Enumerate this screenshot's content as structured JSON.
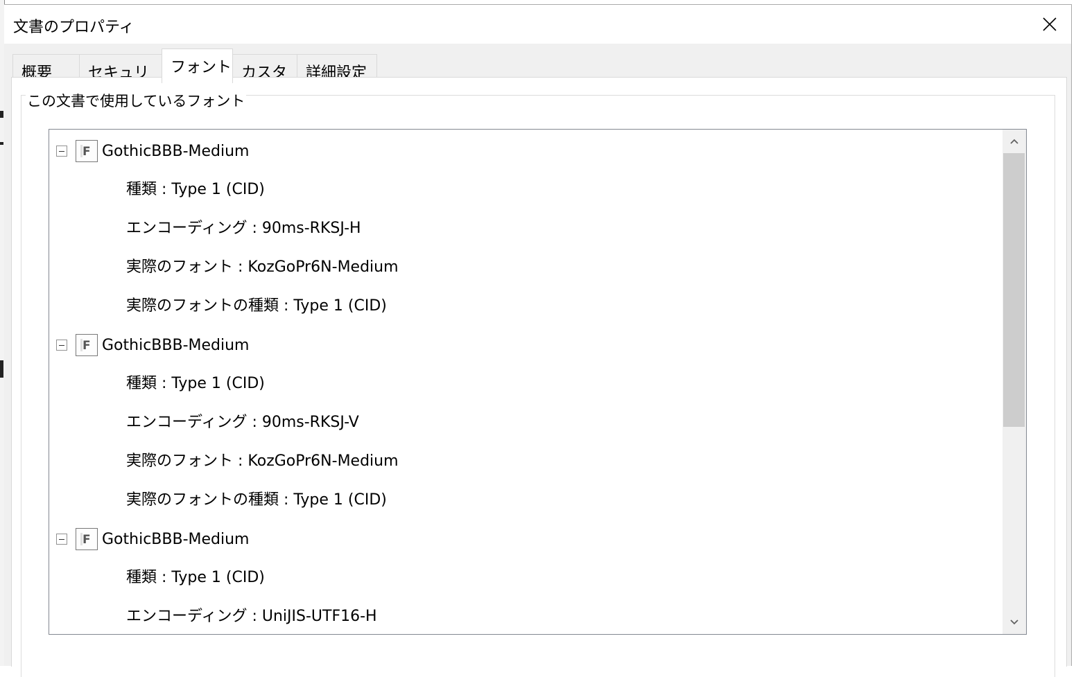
{
  "window": {
    "title": "文書のプロパティ",
    "close_icon": "close-icon"
  },
  "tabs": [
    {
      "label": "概要",
      "active": false
    },
    {
      "label": "セキュリティ",
      "active": false
    },
    {
      "label": "フォント",
      "active": true
    },
    {
      "label": "カスタム",
      "active": false
    },
    {
      "label": "詳細設定",
      "active": false
    }
  ],
  "fonts_group": {
    "label": "この文書で使用しているフォント",
    "fonts": [
      {
        "name": "GothicBBB-Medium",
        "icon": "font-file-icon",
        "props": [
          "種類 : Type 1 (CID)",
          "エンコーディング : 90ms-RKSJ-H",
          "実際のフォント : KozGoPr6N-Medium",
          "実際のフォントの種類 : Type 1 (CID)"
        ]
      },
      {
        "name": "GothicBBB-Medium",
        "icon": "font-file-icon",
        "props": [
          "種類 : Type 1 (CID)",
          "エンコーディング : 90ms-RKSJ-V",
          "実際のフォント : KozGoPr6N-Medium",
          "実際のフォントの種類 : Type 1 (CID)"
        ]
      },
      {
        "name": "GothicBBB-Medium",
        "icon": "font-file-icon",
        "props": [
          "種類 : Type 1 (CID)",
          "エンコーディング : UniJIS-UTF16-H"
        ]
      }
    ]
  },
  "colors": {
    "dialog_bg": "#f0f0f0",
    "content_bg": "#ffffff",
    "scroll_thumb": "#cdcdcd"
  }
}
